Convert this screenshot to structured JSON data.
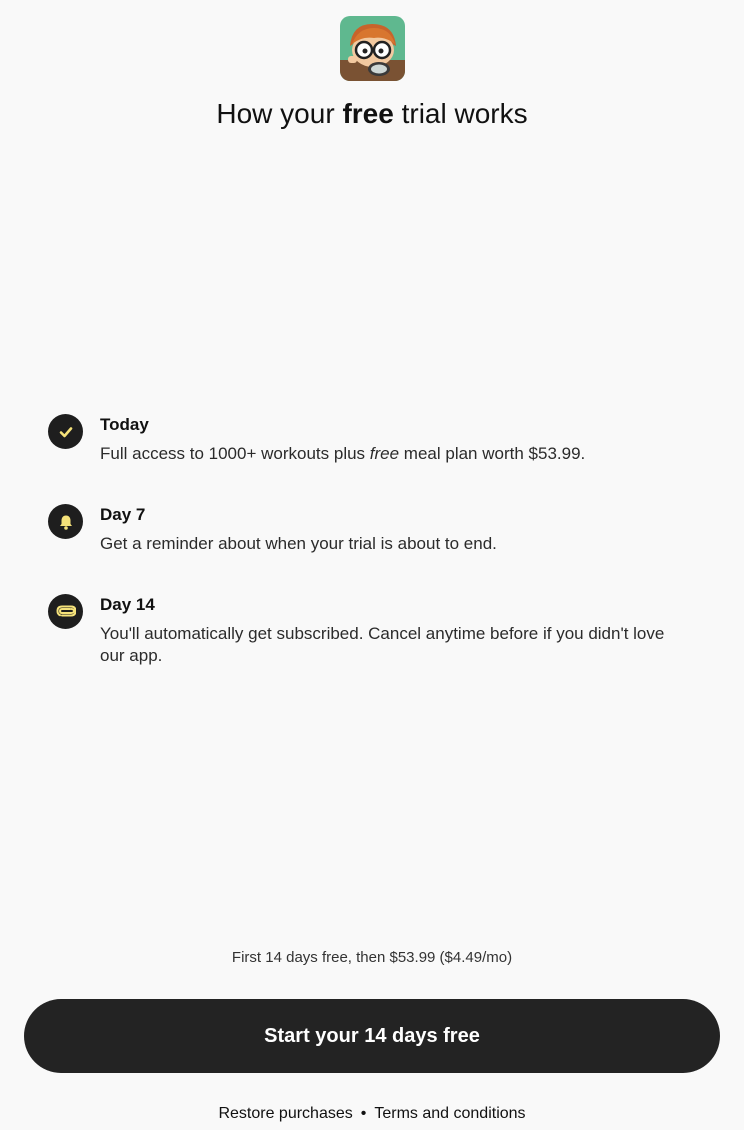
{
  "header": {
    "title_prefix": "How your ",
    "title_emphasis": "free",
    "title_suffix": " trial works"
  },
  "timeline": {
    "steps": [
      {
        "title": "Today",
        "desc_prefix": "Full access to 1000+ workouts plus ",
        "desc_emphasis": "free",
        "desc_suffix": " meal plan worth $53.99.",
        "icon": "checkmark-icon"
      },
      {
        "title": "Day 7",
        "desc": "Get a reminder about when your trial is about to end.",
        "icon": "bell-icon"
      },
      {
        "title": "Day 14",
        "desc": "You'll automatically get subscribed. Cancel anytime before if you didn't love our app.",
        "icon": "paperclip-icon"
      }
    ]
  },
  "pricing": {
    "note": "First 14 days free, then $53.99 ($4.49/mo)"
  },
  "cta": {
    "label": "Start your 14 days free"
  },
  "footer": {
    "restore_label": "Restore purchases",
    "separator": "•",
    "terms_label": "Terms and conditions"
  },
  "colors": {
    "background": "#f9f9f9",
    "icon_bg": "#1e1e1e",
    "icon_accent": "#f5e27a",
    "cta_bg": "#232323",
    "cta_text": "#ffffff"
  }
}
